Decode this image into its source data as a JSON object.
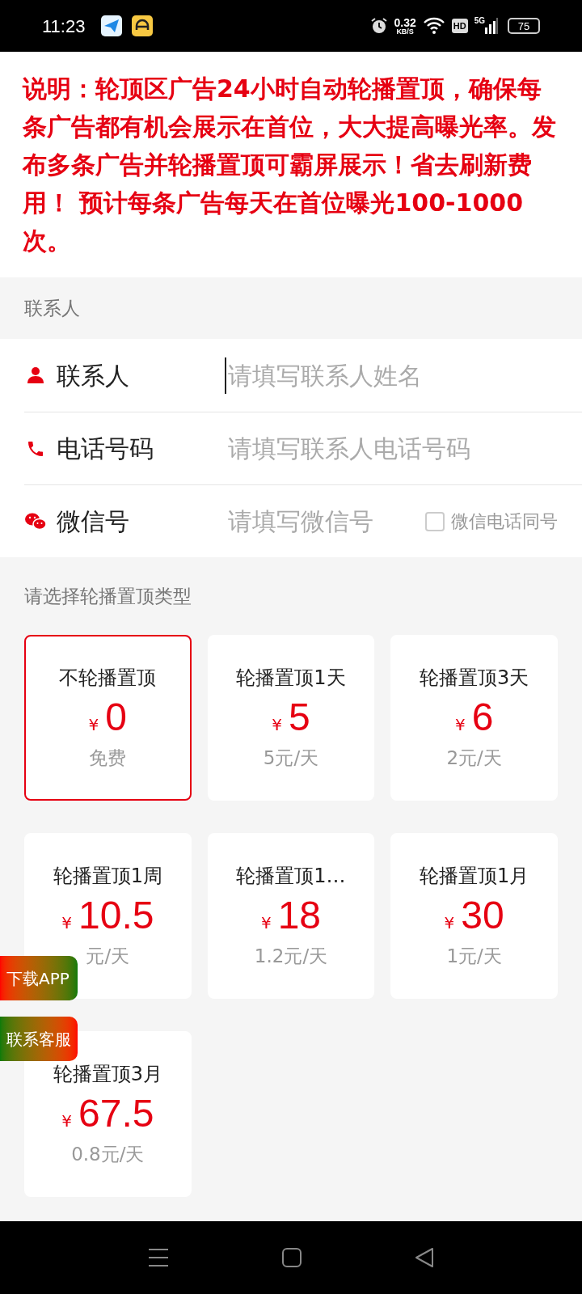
{
  "status_bar": {
    "time": "11:23",
    "speed": "0.32",
    "speed_unit": "KB/S",
    "hd": "HD",
    "network": "5G",
    "battery": "75"
  },
  "notice": "说明：轮顶区广告24小时自动轮播置顶，确保每条广告都有机会展示在首位，大大提高曝光率。发布多条广告并轮播置顶可霸屏展示！省去刷新费用！ 预计每条广告每天在首位曝光100-1000次。",
  "contact_section": {
    "title": "联系人",
    "fields": [
      {
        "kind": "person",
        "label": "联系人",
        "placeholder": "请填写联系人姓名",
        "focused": true
      },
      {
        "kind": "phone",
        "label": "电话号码",
        "placeholder": "请填写联系人电话号码",
        "focused": false
      },
      {
        "kind": "wechat",
        "label": "微信号",
        "placeholder": "请填写微信号",
        "focused": false,
        "checkbox": {
          "label": "微信电话同号",
          "checked": false
        }
      }
    ]
  },
  "type_section": {
    "title": "请选择轮播置顶类型",
    "options": [
      {
        "title": "不轮播置顶",
        "currency": "¥",
        "price": "0",
        "note": "免费",
        "selected": true
      },
      {
        "title": "轮播置顶1天",
        "currency": "¥",
        "price": "5",
        "note": "5元/天",
        "selected": false
      },
      {
        "title": "轮播置顶3天",
        "currency": "¥",
        "price": "6",
        "note": "2元/天",
        "selected": false
      },
      {
        "title": "轮播置顶1周",
        "currency": "¥",
        "price": "10.5",
        "note": "元/天",
        "selected": false
      },
      {
        "title": "轮播置顶1…",
        "currency": "¥",
        "price": "18",
        "note": "1.2元/天",
        "selected": false
      },
      {
        "title": "轮播置顶1月",
        "currency": "¥",
        "price": "30",
        "note": "1元/天",
        "selected": false
      },
      {
        "title": "轮播置顶3月",
        "currency": "¥",
        "price": "67.5",
        "note": "0.8元/天",
        "selected": false
      }
    ]
  },
  "floating_buttons": [
    {
      "label": "下载APP",
      "kind": "download"
    },
    {
      "label": "联系客服",
      "kind": "service"
    }
  ]
}
